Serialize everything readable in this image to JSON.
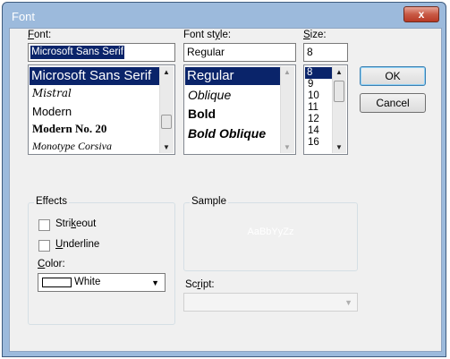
{
  "window": {
    "title": "Font",
    "close_label": "x"
  },
  "font": {
    "label": "Font:",
    "access_key": "F",
    "label_rest": "ont:",
    "value": "Microsoft Sans Serif",
    "items": [
      "Microsoft Sans Serif",
      "Mistral",
      "Modern",
      "Modern No. 20",
      "Monotype Corsiva"
    ],
    "selected_index": 0
  },
  "style": {
    "label_pre": "Font st",
    "access_key": "y",
    "label_post": "le:",
    "value": "Regular",
    "items": [
      "Regular",
      "Oblique",
      "Bold",
      "Bold Oblique"
    ],
    "selected_index": 0
  },
  "size": {
    "access_key": "S",
    "label_rest": "ize:",
    "value": "8",
    "items": [
      "8",
      "9",
      "10",
      "11",
      "12",
      "14",
      "16"
    ],
    "selected_index": 0
  },
  "buttons": {
    "ok": "OK",
    "cancel": "Cancel"
  },
  "effects": {
    "title": "Effects",
    "strikeout_pre": "Stri",
    "strikeout_key": "k",
    "strikeout_post": "eout",
    "underline_key": "U",
    "underline_rest": "nderline",
    "color_key": "C",
    "color_rest": "olor:",
    "color_value": "White",
    "color_swatch": "#ffffff"
  },
  "sample": {
    "title": "Sample",
    "text": "AaBbYyZz"
  },
  "script": {
    "pre": "Sc",
    "key": "r",
    "post": "ipt:",
    "value": ""
  },
  "colors": {
    "selection": "#0a246a",
    "title_text": "#ffffff",
    "sample_text": "#ffffff"
  }
}
